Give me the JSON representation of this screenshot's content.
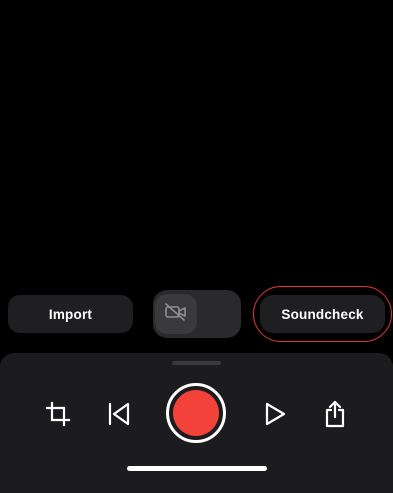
{
  "toolbar": {
    "import_label": "Import",
    "soundcheck_label": "Soundcheck",
    "camera_toggle_icon": "video-off-icon",
    "soundcheck_ring_color": "#e0353a"
  },
  "controls": {
    "icons": [
      "crop-icon",
      "skip-back-icon",
      "record-icon",
      "play-icon",
      "share-icon"
    ],
    "record_color": "#f2423a"
  }
}
